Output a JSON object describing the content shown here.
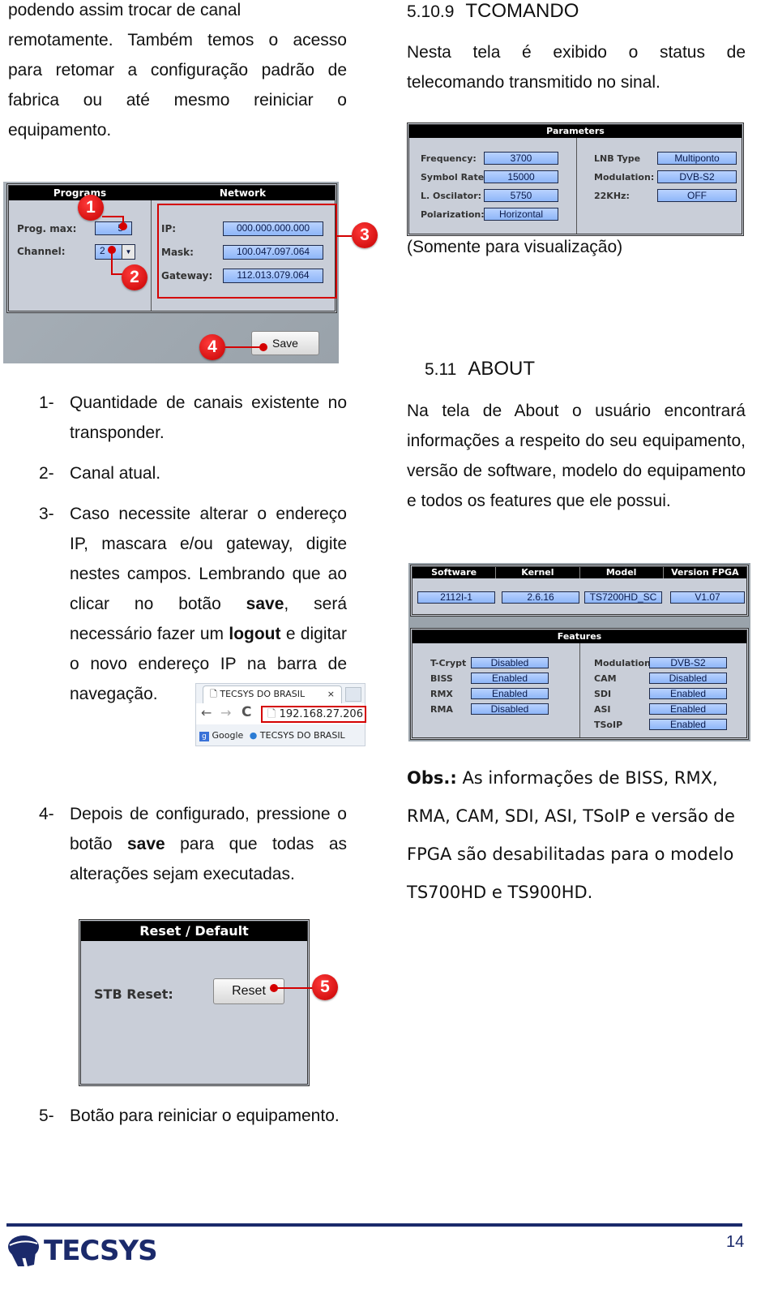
{
  "left": {
    "intro_lines": [
      "podendo assim trocar de canal",
      "remotamente. Também temos o acesso",
      "para retomar a configuração padrão de",
      "fabrica ou até mesmo reiniciar o",
      "equipamento."
    ],
    "network_ui": {
      "programs_title": "Programs",
      "network_title": "Network",
      "prog_max_label": "Prog. max:",
      "prog_max_value": "5",
      "channel_label": "Channel:",
      "channel_value": "2",
      "ip_label": "IP:",
      "ip_value": "000.000.000.000",
      "mask_label": "Mask:",
      "mask_value": "100.047.097.064",
      "gateway_label": "Gateway:",
      "gateway_value": "112.013.079.064",
      "save_label": "Save",
      "callouts": [
        "1",
        "2",
        "3",
        "4"
      ]
    },
    "list": [
      {
        "num": "1-",
        "text": "Quantidade de canais existente no transponder."
      },
      {
        "num": "2-",
        "text": "Canal atual."
      },
      {
        "num": "3-",
        "text_parts": [
          "Caso necessite alterar o endereço IP, mascara e/ou gateway, digite nestes campos. Lembrando que ao clicar no botão ",
          "save",
          ", será necessário fazer um ",
          "logout",
          " e digitar o novo endereço IP na barra de navegação."
        ]
      },
      {
        "num": "4-",
        "text_parts": [
          "Depois de configurado, pressione o botão ",
          "save",
          " para que todas as alterações sejam executadas."
        ]
      }
    ],
    "browser": {
      "tab_title": "TECSYS DO BRASIL",
      "tab_close": "×",
      "address": "192.168.27.206",
      "bookmark_google": "Google",
      "bookmark_tecsys": "TECSYS DO BRASIL"
    },
    "reset_ui": {
      "title": "Reset / Default",
      "stb_label": "STB Reset:",
      "reset_label": "Reset",
      "callout": "5"
    },
    "item5": {
      "num": "5-",
      "text": "Botão para reiniciar o equipamento."
    }
  },
  "right": {
    "tcomando": {
      "number": "5.10.9",
      "title": "TCOMANDO",
      "text": "Nesta tela é exibido o status de telecomando transmitido no sinal.",
      "caption": "(Somente para visualização)"
    },
    "parameters_ui": {
      "title": "Parameters",
      "left": [
        {
          "label": "Frequency:",
          "value": "3700"
        },
        {
          "label": "Symbol Rate:",
          "value": "15000"
        },
        {
          "label": "L. Oscilator:",
          "value": "5750"
        },
        {
          "label": "Polarization:",
          "value": "Horizontal"
        }
      ],
      "right": [
        {
          "label": "LNB Type",
          "value": "Multiponto"
        },
        {
          "label": "Modulation:",
          "value": "DVB-S2"
        },
        {
          "label": "22KHz:",
          "value": "OFF"
        }
      ]
    },
    "about": {
      "number": "5.11",
      "title": "ABOUT",
      "text": "Na tela de About o usuário encontrará informações a respeito do seu equipamento, versão de software, modelo do equipamento e todos os features que ele possui."
    },
    "about_ui": {
      "headers": [
        "Software",
        "Kernel",
        "Model",
        "Version FPGA"
      ],
      "values": [
        "2112I-1",
        "2.6.16",
        "TS7200HD_SC",
        "V1.07"
      ],
      "features_title": "Features",
      "features_left": [
        {
          "label": "T-Crypt",
          "value": "Disabled"
        },
        {
          "label": "BISS",
          "value": "Enabled"
        },
        {
          "label": "RMX",
          "value": "Enabled"
        },
        {
          "label": "RMA",
          "value": "Disabled"
        }
      ],
      "features_right": [
        {
          "label": "Modulation",
          "value": "DVB-S2"
        },
        {
          "label": "CAM",
          "value": "Disabled"
        },
        {
          "label": "SDI",
          "value": "Enabled"
        },
        {
          "label": "ASI",
          "value": "Enabled"
        },
        {
          "label": "TSoIP",
          "value": "Enabled"
        }
      ]
    },
    "obs": {
      "label": "Obs.:",
      "text": " As informações de BISS, RMX, RMA, CAM, SDI, ASI, TSoIP e versão de FPGA são desabilitadas para o modelo TS700HD e TS900HD."
    }
  },
  "footer": {
    "brand": "TECSYS",
    "page_number": "14",
    "rule_color": "#1b2a6b"
  }
}
